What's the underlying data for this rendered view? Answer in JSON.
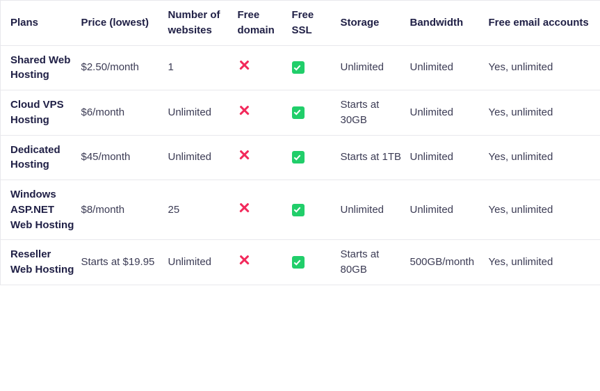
{
  "table": {
    "columns": [
      {
        "key": "plan",
        "label": "Plans"
      },
      {
        "key": "price",
        "label": "Price (lowest)"
      },
      {
        "key": "sites",
        "label": "Number of websites"
      },
      {
        "key": "domain",
        "label": "Free domain"
      },
      {
        "key": "ssl",
        "label": "Free SSL"
      },
      {
        "key": "storage",
        "label": "Storage"
      },
      {
        "key": "bandwidth",
        "label": "Bandwidth"
      },
      {
        "key": "email",
        "label": "Free email accounts"
      }
    ],
    "rows": [
      {
        "plan": "Shared Web Hosting",
        "price": "$2.50/month",
        "sites": "1",
        "domain": "no",
        "domain_icon": "cross-icon",
        "ssl": "yes",
        "ssl_icon": "check-icon",
        "storage": "Unlimited",
        "bandwidth": "Unlimited",
        "email": "Yes, unlimited"
      },
      {
        "plan": "Cloud VPS Hosting",
        "price": "$6/month",
        "sites": "Unlimited",
        "domain": "no",
        "domain_icon": "cross-icon",
        "ssl": "yes",
        "ssl_icon": "check-icon",
        "storage": "Starts at 30GB",
        "bandwidth": "Unlimited",
        "email": "Yes, unlimited"
      },
      {
        "plan": "Dedicated Hosting",
        "price": "$45/month",
        "sites": "Unlimited",
        "domain": "no",
        "domain_icon": "cross-icon",
        "ssl": "yes",
        "ssl_icon": "check-icon",
        "storage": "Starts at 1TB",
        "bandwidth": "Unlimited",
        "email": "Yes, unlimited"
      },
      {
        "plan": "Windows ASP.NET Web Hosting",
        "price": "$8/month",
        "sites": "25",
        "domain": "no",
        "domain_icon": "cross-icon",
        "ssl": "yes",
        "ssl_icon": "check-icon",
        "storage": "Unlimited",
        "bandwidth": "Unlimited",
        "email": "Yes, unlimited"
      },
      {
        "plan": "Reseller Web Hosting",
        "price": "Starts at $19.95",
        "sites": "Unlimited",
        "domain": "no",
        "domain_icon": "cross-icon",
        "ssl": "yes",
        "ssl_icon": "check-icon",
        "storage": "Starts at 80GB",
        "bandwidth": "500GB/month",
        "email": "Yes, unlimited"
      }
    ]
  },
  "colors": {
    "heading_text": "#202046",
    "body_text": "#3b3b54",
    "border": "#e8e8ec",
    "cross": "#f2295b",
    "check": "#21ce6a",
    "background": "#ffffff"
  }
}
